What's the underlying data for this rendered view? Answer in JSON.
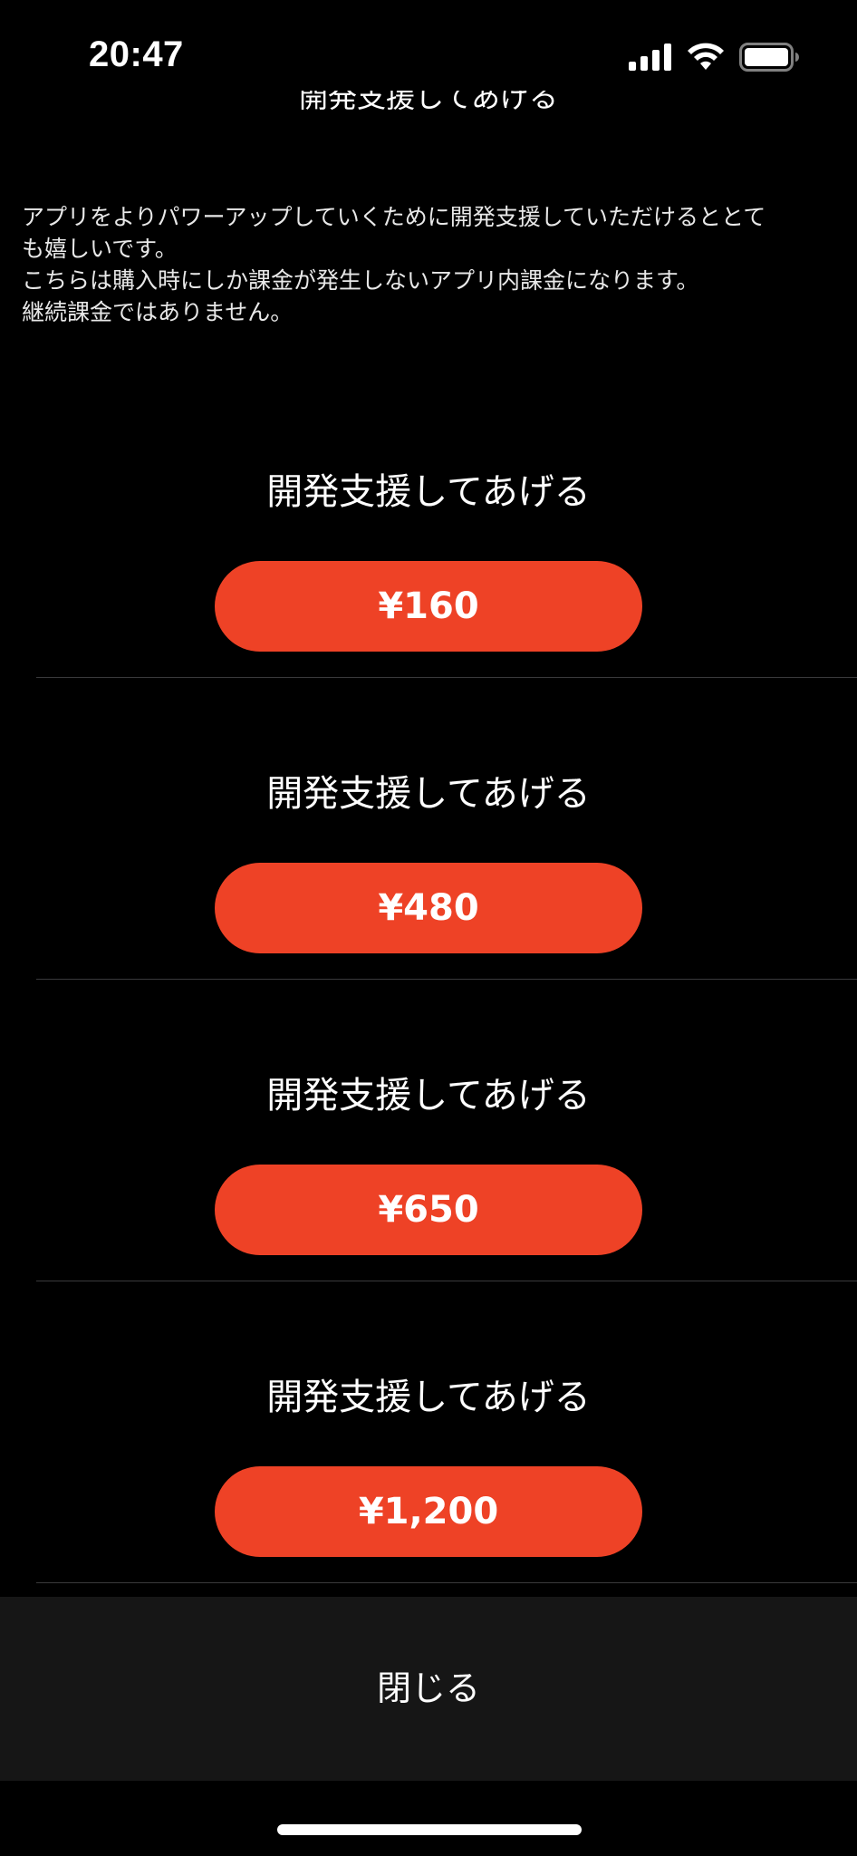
{
  "status_bar": {
    "time": "20:47",
    "icons": [
      "signal-icon",
      "wifi-icon",
      "battery-icon"
    ]
  },
  "header": {
    "title": "開発支援してあげる"
  },
  "description": {
    "lines": [
      "アプリをよりパワーアップしていくために開発支援していただけるととて",
      "も嬉しいです。",
      "こちらは購入時にしか課金が発生しないアプリ内課金になります。",
      "継続課金ではありません。"
    ]
  },
  "tiers": [
    {
      "label": "開発支援してあげる",
      "price": "¥160"
    },
    {
      "label": "開発支援してあげる",
      "price": "¥480"
    },
    {
      "label": "開発支援してあげる",
      "price": "¥650"
    },
    {
      "label": "開発支援してあげる",
      "price": "¥1,200"
    }
  ],
  "footer": {
    "close_label": "閉じる"
  },
  "colors": {
    "background": "#000000",
    "accent": "#ee4226",
    "footer_bg": "#161616",
    "divider": "#3a3a3c"
  }
}
